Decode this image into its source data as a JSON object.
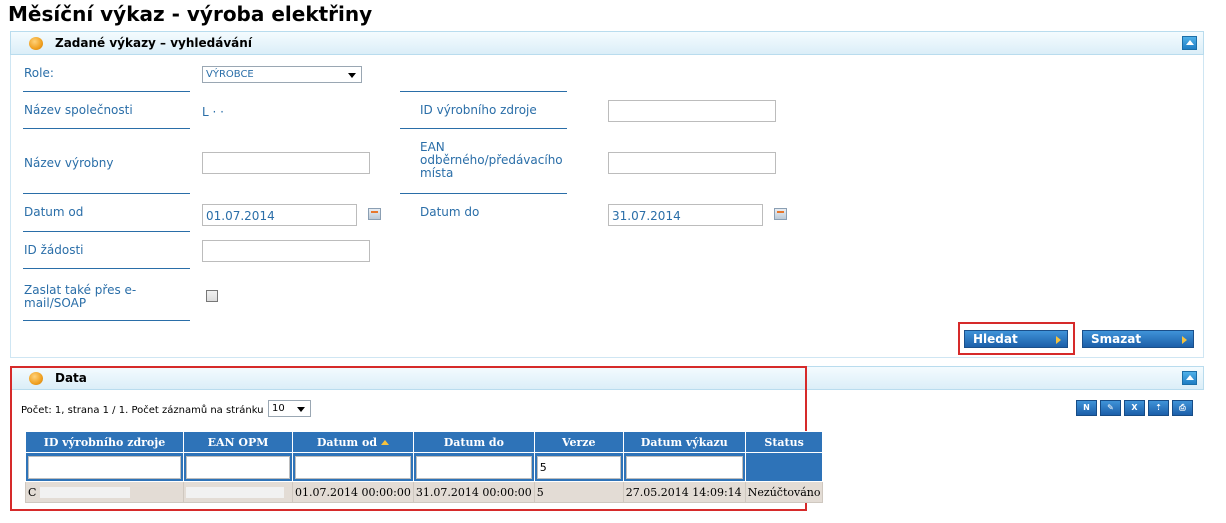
{
  "page_title": "Měsíční výkaz - výroba elektřiny",
  "search_panel": {
    "title": "Zadané výkazy – vyhledávání",
    "role_label": "Role:",
    "role_value": "VÝROBCE",
    "company_label": "Název společnosti",
    "company_value": "L ·  ·   ",
    "source_id_label": "ID výrobního zdroje",
    "source_id_value": "",
    "plant_label": "Název výrobny",
    "plant_value": "",
    "ean_label_1": "EAN",
    "ean_label_2": "odběrného/předávacího",
    "ean_label_3": "místa",
    "ean_value": "",
    "date_from_label": "Datum od",
    "date_from_value": "01.07.2014",
    "date_to_label": "Datum do",
    "date_to_value": "31.07.2014",
    "request_id_label": "ID žádosti",
    "request_id_value": "",
    "email_label_1": "Zaslat také přes e-",
    "email_label_2": "mail/SOAP",
    "email_checked": false,
    "search_button": "Hledat",
    "clear_button": "Smazat"
  },
  "data_panel": {
    "title": "Data",
    "count_text": "Počet: 1, strana 1 / 1. Počet záznamů na stránku",
    "page_size": "10",
    "toolbar_icons": [
      "new-record-icon",
      "edit-icon",
      "excel-export-icon",
      "import-icon",
      "print-icon"
    ],
    "columns": [
      "ID výrobního zdroje",
      "EAN OPM",
      "Datum od",
      "Datum do",
      "Verze",
      "Datum výkazu",
      "Status"
    ],
    "filters": [
      "",
      "",
      "",
      "",
      "5",
      "",
      ""
    ],
    "rows": [
      {
        "source_id": "C",
        "ean": "",
        "date_from": "01.07.2014 00:00:00",
        "date_to": "31.07.2014 00:00:00",
        "version": "5",
        "report_date": "27.05.2014 14:09:14",
        "status": "Nezúčtováno"
      }
    ]
  },
  "colors": {
    "accent": "#2e73b8",
    "label": "#2a6ea8",
    "highlight": "#d62a2a"
  }
}
